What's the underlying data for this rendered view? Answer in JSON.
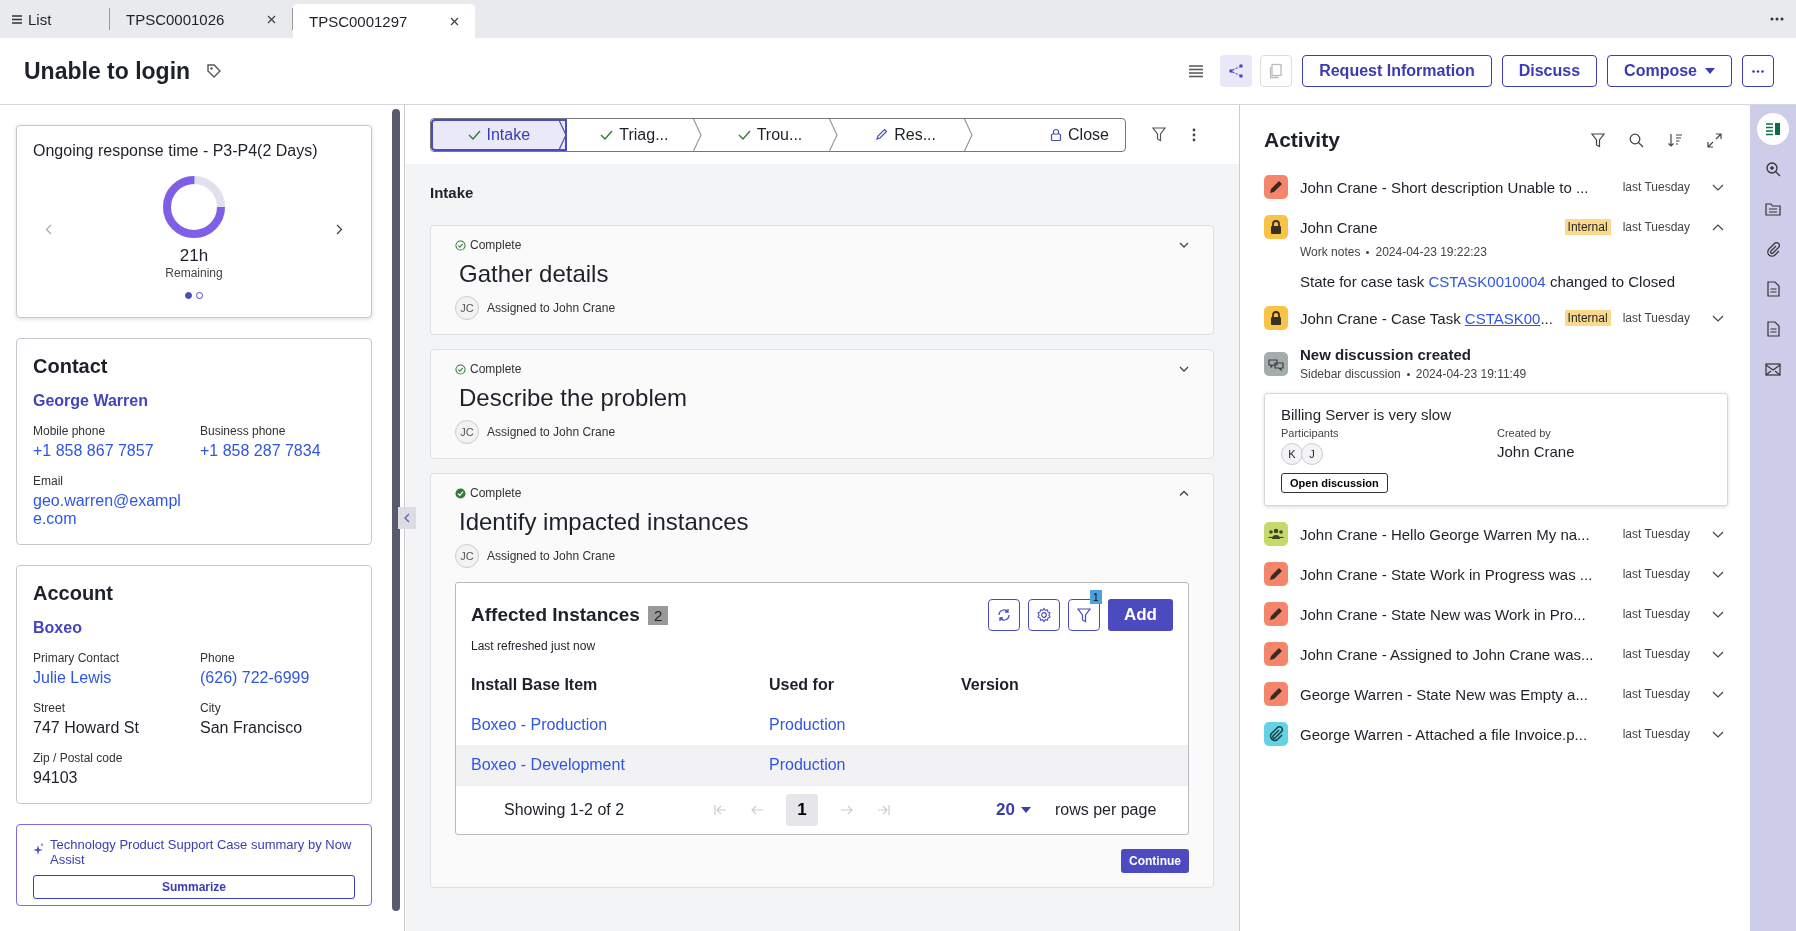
{
  "tabs": [
    {
      "kind": "list",
      "label": "List",
      "selected": false
    },
    {
      "kind": "record",
      "label": "TPSC0001026",
      "selected": false
    },
    {
      "kind": "record",
      "label": "TPSC0001297",
      "selected": true
    }
  ],
  "header": {
    "title": "Unable to login",
    "view_buttons": [
      {
        "kind": "list",
        "selected": false,
        "disabled": false
      },
      {
        "kind": "flow",
        "selected": true,
        "disabled": false
      },
      {
        "kind": "copy",
        "selected": false,
        "disabled": true
      }
    ],
    "actions": [
      {
        "label": "Request Information",
        "kind": "plain"
      },
      {
        "label": "Discuss",
        "kind": "plain"
      },
      {
        "label": "Compose",
        "kind": "dropdown"
      }
    ]
  },
  "sla": {
    "title": "Ongoing response time - P3-P4(2 Days)",
    "level": 0.75,
    "value": "21h",
    "caption": "Remaining",
    "pages": [
      {
        "selected": true
      },
      {
        "selected": false
      }
    ]
  },
  "contact": {
    "heading": "Contact",
    "name": "George Warren",
    "fields": [
      {
        "label": "Mobile phone",
        "value": "+1 858 867 7857",
        "link": true
      },
      {
        "label": "Business phone",
        "value": "+1 858 287 7834",
        "link": true
      },
      {
        "label": "Email",
        "value": "geo.warren@example.com",
        "link": true
      }
    ]
  },
  "account": {
    "heading": "Account",
    "name": "Boxeo",
    "fields": [
      {
        "label": "Primary Contact",
        "value": "Julie Lewis",
        "link": true
      },
      {
        "label": "Phone",
        "value": "(626) 722-6999",
        "link": true
      },
      {
        "label": "Street",
        "value": "747 Howard St",
        "link": false
      },
      {
        "label": "City",
        "value": "San Francisco",
        "link": false
      },
      {
        "label": "Zip / Postal code",
        "value": "94103",
        "link": false
      }
    ]
  },
  "summary": {
    "text": "Technology Product Support Case summary by Now Assist",
    "button": "Summarize"
  },
  "stepper": [
    {
      "label": "Intake",
      "kind": "done",
      "selected": true
    },
    {
      "label": "Triag...",
      "kind": "done",
      "selected": false
    },
    {
      "label": "Trou...",
      "kind": "done",
      "selected": false
    },
    {
      "label": "Res...",
      "kind": "edit",
      "selected": false
    },
    {
      "label": "Close",
      "kind": "locked",
      "selected": false
    }
  ],
  "section": "Intake",
  "tasks": [
    {
      "status": "Complete",
      "title": "Gather details",
      "initials": "JC",
      "assigned": "Assigned to John Crane",
      "expanded": false
    },
    {
      "status": "Complete",
      "title": "Describe the problem",
      "initials": "JC",
      "assigned": "Assigned to John Crane",
      "expanded": false
    },
    {
      "status": "Complete",
      "title": "Identify impacted instances",
      "initials": "JC",
      "assigned": "Assigned to John Crane",
      "expanded": true
    }
  ],
  "instances": {
    "title": "Affected Instances",
    "count": "2",
    "refreshed": "Last refreshed just now",
    "filter_badge": "1",
    "add": "Add",
    "columns": [
      "Install Base Item",
      "Used for",
      "Version"
    ],
    "rows": [
      {
        "cells": [
          "Boxeo - Production",
          "Production"
        ],
        "highlighted": false
      },
      {
        "cells": [
          "Boxeo - Development",
          "Production"
        ],
        "highlighted": true
      }
    ],
    "showing": "Showing 1-2 of 2",
    "page": "1",
    "per_page": "20",
    "per_page_label": "rows per page"
  },
  "continue": "Continue",
  "activity": {
    "title": "Activity",
    "items": [
      {
        "kind": "edit",
        "color": "#f5866c",
        "text": "John Crane - Short description Unable to ...",
        "time": "last Tuesday",
        "internal": false,
        "expanded": false
      },
      {
        "kind": "note",
        "color": "#f8c347",
        "text": "John Crane",
        "internal_label": "Internal",
        "internal": true,
        "time": "last Tuesday",
        "expanded": true,
        "meta": "Work notes",
        "date": "2024-04-23 19:22:23",
        "body": [
          "State for case task ",
          "CSTASK0010004",
          " changed to Closed"
        ]
      },
      {
        "kind": "note",
        "color": "#f8c347",
        "text": "John Crane - Case Task ",
        "link": "CSTASK00",
        "ellipsis": "...",
        "internal_label": "Internal",
        "internal": true,
        "time": "last Tuesday",
        "expanded": false
      },
      {
        "kind": "discussion",
        "color": "#a4adab",
        "text": "New discussion created",
        "meta": "Sidebar discussion",
        "date": "2024-04-23 19:11:49",
        "card": {
          "title": "Billing Server is very slow",
          "participants_label": "Participants",
          "participants": [
            "K",
            "J"
          ],
          "created_label": "Created by",
          "created_by": "John Crane",
          "button": "Open discussion"
        }
      },
      {
        "kind": "group",
        "color": "#c6d96c",
        "text": "John Crane - Hello George Warren My na...",
        "time": "last Tuesday",
        "internal": false,
        "expanded": false
      },
      {
        "kind": "edit",
        "color": "#f5866c",
        "text": "John Crane - State Work in Progress was ...",
        "time": "last Tuesday",
        "internal": false,
        "expanded": false
      },
      {
        "kind": "edit",
        "color": "#f5866c",
        "text": "John Crane - State New was Work in Pro...",
        "time": "last Tuesday",
        "internal": false,
        "expanded": false
      },
      {
        "kind": "edit",
        "color": "#f5866c",
        "text": "John Crane - Assigned to John Crane was...",
        "time": "last Tuesday",
        "internal": false,
        "expanded": false
      },
      {
        "kind": "edit",
        "color": "#f5866c",
        "text": "George Warren - State New was Empty a...",
        "time": "last Tuesday",
        "internal": false,
        "expanded": false
      },
      {
        "kind": "attach",
        "color": "#61d3e4",
        "text": "George Warren - Attached a file Invoice.p...",
        "time": "last Tuesday",
        "internal": false,
        "expanded": false
      }
    ]
  },
  "rail": [
    {
      "kind": "activity",
      "selected": true
    },
    {
      "kind": "search",
      "selected": false
    },
    {
      "kind": "folder",
      "selected": false
    },
    {
      "kind": "attach",
      "selected": false
    },
    {
      "kind": "doc",
      "selected": false
    },
    {
      "kind": "doc",
      "selected": false
    },
    {
      "kind": "mail",
      "selected": false
    }
  ]
}
